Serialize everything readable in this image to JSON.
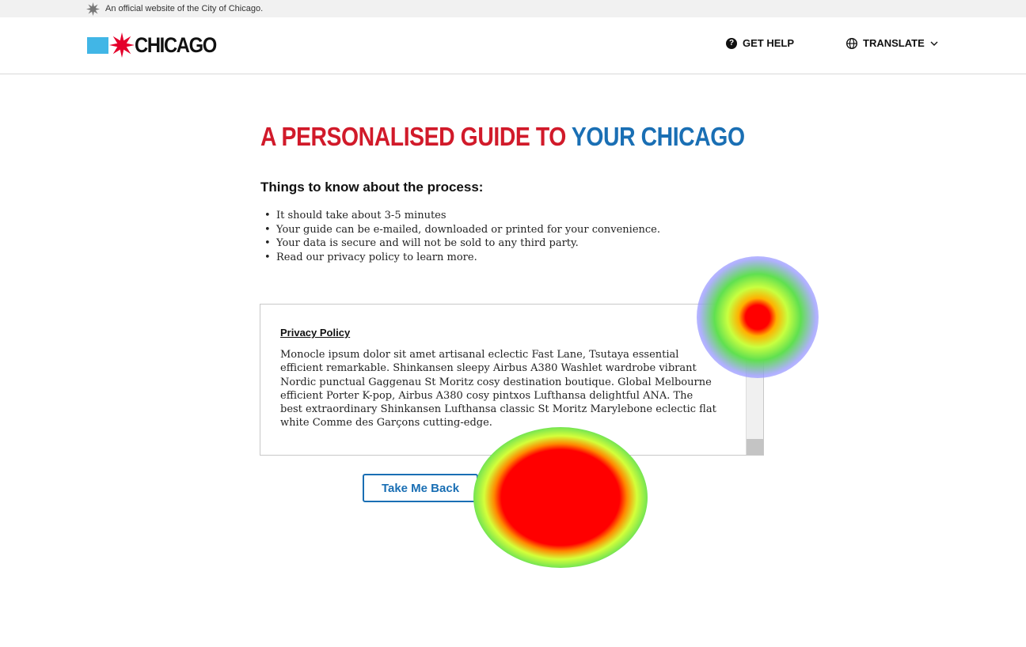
{
  "official_bar": {
    "text": "An official website of the City of Chicago."
  },
  "header": {
    "logo_text": "CHICAGO",
    "get_help": "GET HELP",
    "translate": "TRANSLATE"
  },
  "main": {
    "title_part1": "A PERSONALISED GUIDE TO ",
    "title_part2": "YOUR CHICAGO",
    "subtitle": "Things to know about the process:",
    "bullets": [
      "It should take about 3-5 minutes",
      "Your guide can be e-mailed, downloaded or printed for your convenience.",
      "Your data is secure and will not be sold to any third party.",
      "Read our privacy policy to learn more."
    ]
  },
  "policy": {
    "title": "Privacy Policy",
    "body": "Monocle ipsum dolor sit amet artisanal eclectic Fast Lane, Tsutaya essential efficient remarkable. Shinkansen sleepy Airbus A380 Washlet wardrobe vibrant Nordic punctual Gaggenau St Moritz cosy destination boutique. Global Melbourne efficient Porter K-pop, Airbus A380 cosy pintxos Lufthansa delightful ANA. The best extraordinary Shinkansen Lufthansa classic St Moritz Marylebone eclectic flat white Comme des Garçons cutting-edge."
  },
  "buttons": {
    "back": "Take Me Back",
    "continue": ""
  },
  "colors": {
    "brand_red": "#d11a2a",
    "brand_blue": "#1a6fb4",
    "flag_blue": "#41b6e6",
    "continue_bg": "#0f6b6b"
  },
  "icons": {
    "official": "star-icon",
    "logo": "chicago-star-icon",
    "help": "question-circle-icon",
    "translate": "globe-icon",
    "dropdown": "chevron-down-icon"
  }
}
